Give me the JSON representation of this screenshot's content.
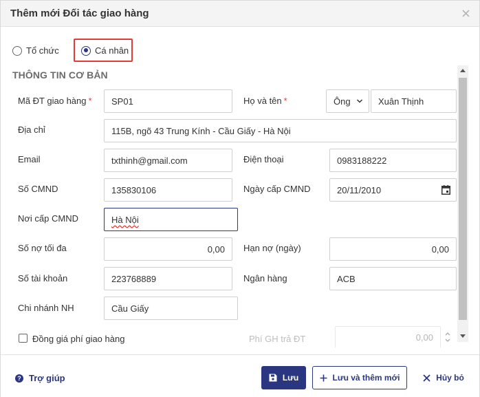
{
  "dialog": {
    "title": "Thêm mới Đối tác giao hàng",
    "close_icon": "close-icon"
  },
  "type_options": [
    {
      "label": "Tổ chức",
      "selected": false
    },
    {
      "label": "Cá nhân",
      "selected": true
    }
  ],
  "section": {
    "title": "THÔNG TIN CƠ BẢN"
  },
  "fields": {
    "code": {
      "label": "Mã ĐT giao hàng",
      "required": "*",
      "value": "SP01"
    },
    "full_name": {
      "label": "Họ và tên",
      "required": "*",
      "title_value": "Ông",
      "value": "Xuân Thịnh"
    },
    "address": {
      "label": "Địa chỉ",
      "value": "115B, ngõ 43 Trung Kính - Cầu Giấy - Hà Nội"
    },
    "email": {
      "label": "Email",
      "value": "txthinh@gmail.com"
    },
    "phone": {
      "label": "Điện thoại",
      "value": "0983188222"
    },
    "id_number": {
      "label": "Số CMND",
      "value": "135830106"
    },
    "id_issue_date": {
      "label": "Ngày cấp CMND",
      "value": "20/11/2010"
    },
    "id_issue_place": {
      "label": "Nơi cấp CMND",
      "value": "Hà Nội"
    },
    "max_debt": {
      "label": "Số nợ tối đa",
      "value": "0,00"
    },
    "debt_days": {
      "label": "Hạn nợ (ngày)",
      "value": "0,00"
    },
    "account_number": {
      "label": "Số tài khoản",
      "value": "223768889"
    },
    "bank": {
      "label": "Ngân hàng",
      "value": "ACB"
    },
    "branch": {
      "label": "Chi nhánh NH",
      "value": "Cầu Giấy"
    },
    "flat_fee": {
      "label": "Đồng giá phí giao hàng",
      "checked": false
    },
    "return_fee": {
      "label": "Phí GH trả ĐT",
      "value": "0,00"
    }
  },
  "footer": {
    "help_label": "Trợ giúp",
    "save_label": "Lưu",
    "save_new_label": "Lưu và thêm mới",
    "cancel_label": "Hủy bỏ"
  },
  "colors": {
    "primary": "#2a3680",
    "required": "#e53935",
    "highlight": "#e53935"
  }
}
